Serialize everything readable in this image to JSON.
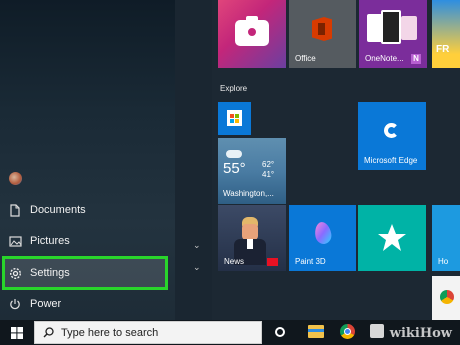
{
  "start_menu": {
    "left_nav": [
      {
        "label": "Documents",
        "icon": "document-icon"
      },
      {
        "label": "Pictures",
        "icon": "pictures-icon"
      },
      {
        "label": "Settings",
        "icon": "gear-icon"
      },
      {
        "label": "Power",
        "icon": "power-icon"
      }
    ],
    "user_avatar": "avatar"
  },
  "tiles": {
    "office_label": "Office",
    "onenote_label": "OneNote...",
    "explore_label": "Explore",
    "weather": {
      "temp": "55°",
      "high": "62°",
      "low": "41°",
      "location": "Washington,..."
    },
    "edge_label": "Microsoft Edge",
    "news_label": "News",
    "paint3d_label": "Paint 3D"
  },
  "taskbar": {
    "search_placeholder": "Type here to search"
  },
  "watermark": "wikiHow",
  "colors": {
    "highlight": "#29d52b",
    "tile_blue": "#0a78d7",
    "taskbar": "#10171d"
  }
}
